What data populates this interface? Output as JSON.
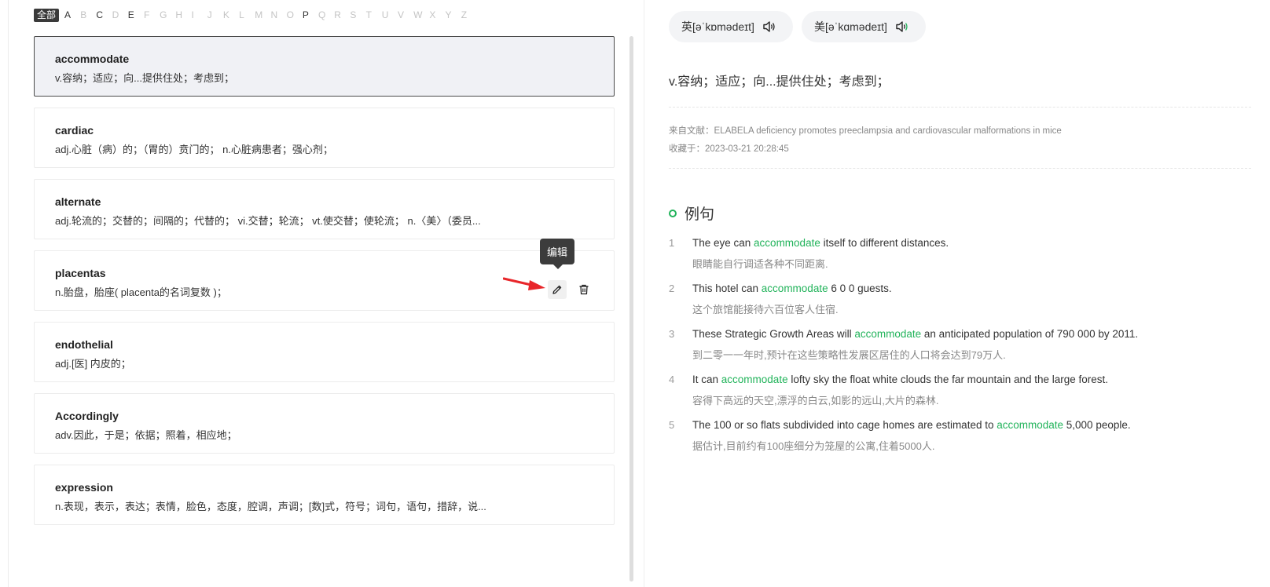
{
  "alphabet": {
    "all_label": "全部",
    "letters": [
      "A",
      "B",
      "C",
      "D",
      "E",
      "F",
      "G",
      "H",
      "I",
      "J",
      "K",
      "L",
      "M",
      "N",
      "O",
      "P",
      "Q",
      "R",
      "S",
      "T",
      "U",
      "V",
      "W",
      "X",
      "Y",
      "Z"
    ],
    "active": [
      "A",
      "C",
      "E",
      "P"
    ]
  },
  "words": [
    {
      "word": "accommodate",
      "def": "v.容纳；适应；向...提供住处；考虑到；"
    },
    {
      "word": "cardiac",
      "def": "adj.心脏（病）的；（胃的）贲门的； n.心脏病患者；强心剂；"
    },
    {
      "word": "alternate",
      "def": "adj.轮流的；交替的；间隔的；代替的； vi.交替；轮流； vt.使交替；使轮流； n.〈美〉（委员..."
    },
    {
      "word": "placentas",
      "def": "n.胎盘，胎座( placenta的名词复数 )；"
    },
    {
      "word": "endothelial",
      "def": "adj.[医] 内皮的；"
    },
    {
      "word": "Accordingly",
      "def": "adv.因此，于是；依据；照着，相应地；"
    },
    {
      "word": "expression",
      "def": "n.表现，表示，表达；表情，脸色，态度，腔调，声调；[数]式，符号；词句，语句，措辞，说..."
    }
  ],
  "tooltip": "编辑",
  "detail": {
    "uk": "英[əˈkɒmədeɪt]",
    "us": "美[əˈkɑmədeɪt]",
    "meaning": "v.容纳；适应；向...提供住处；考虑到；",
    "source_label": "来自文献：",
    "source": "ELABELA deficiency promotes preeclampsia and cardiovascular malformations in mice",
    "collected_label": "收藏于：",
    "collected": "2023-03-21 20:28:45",
    "examples_title": "例句",
    "highlight": "accommodate",
    "examples": [
      {
        "num": "1",
        "pre": "The eye can ",
        "post": " itself to different distances.",
        "cn": "眼睛能自行调适各种不同距离."
      },
      {
        "num": "2",
        "pre": "This hotel can ",
        "post": " 6 0 0 guests.",
        "cn": "这个旅馆能接待六百位客人住宿."
      },
      {
        "num": "3",
        "pre": "These Strategic Growth Areas will ",
        "post": " an anticipated population of 790 000 by 2011.",
        "cn": "到二零一一年时,预计在这些策略性发展区居住的人口将会达到79万人."
      },
      {
        "num": "4",
        "pre": "It can ",
        "post": " lofty sky the float white clouds the far mountain and the large forest.",
        "cn": "容得下高远的天空,漂浮的白云,如影的远山,大片的森林."
      },
      {
        "num": "5",
        "pre": "The 100 or so flats subdivided into cage homes are estimated to ",
        "post": " 5,000 people.",
        "cn": "据估计,目前约有100座细分为笼屋的公寓,住着5000人."
      }
    ]
  },
  "colors": {
    "accent": "#21b35a",
    "tooltip_bg": "#3c3c3c",
    "arrow": "#e8262a"
  }
}
